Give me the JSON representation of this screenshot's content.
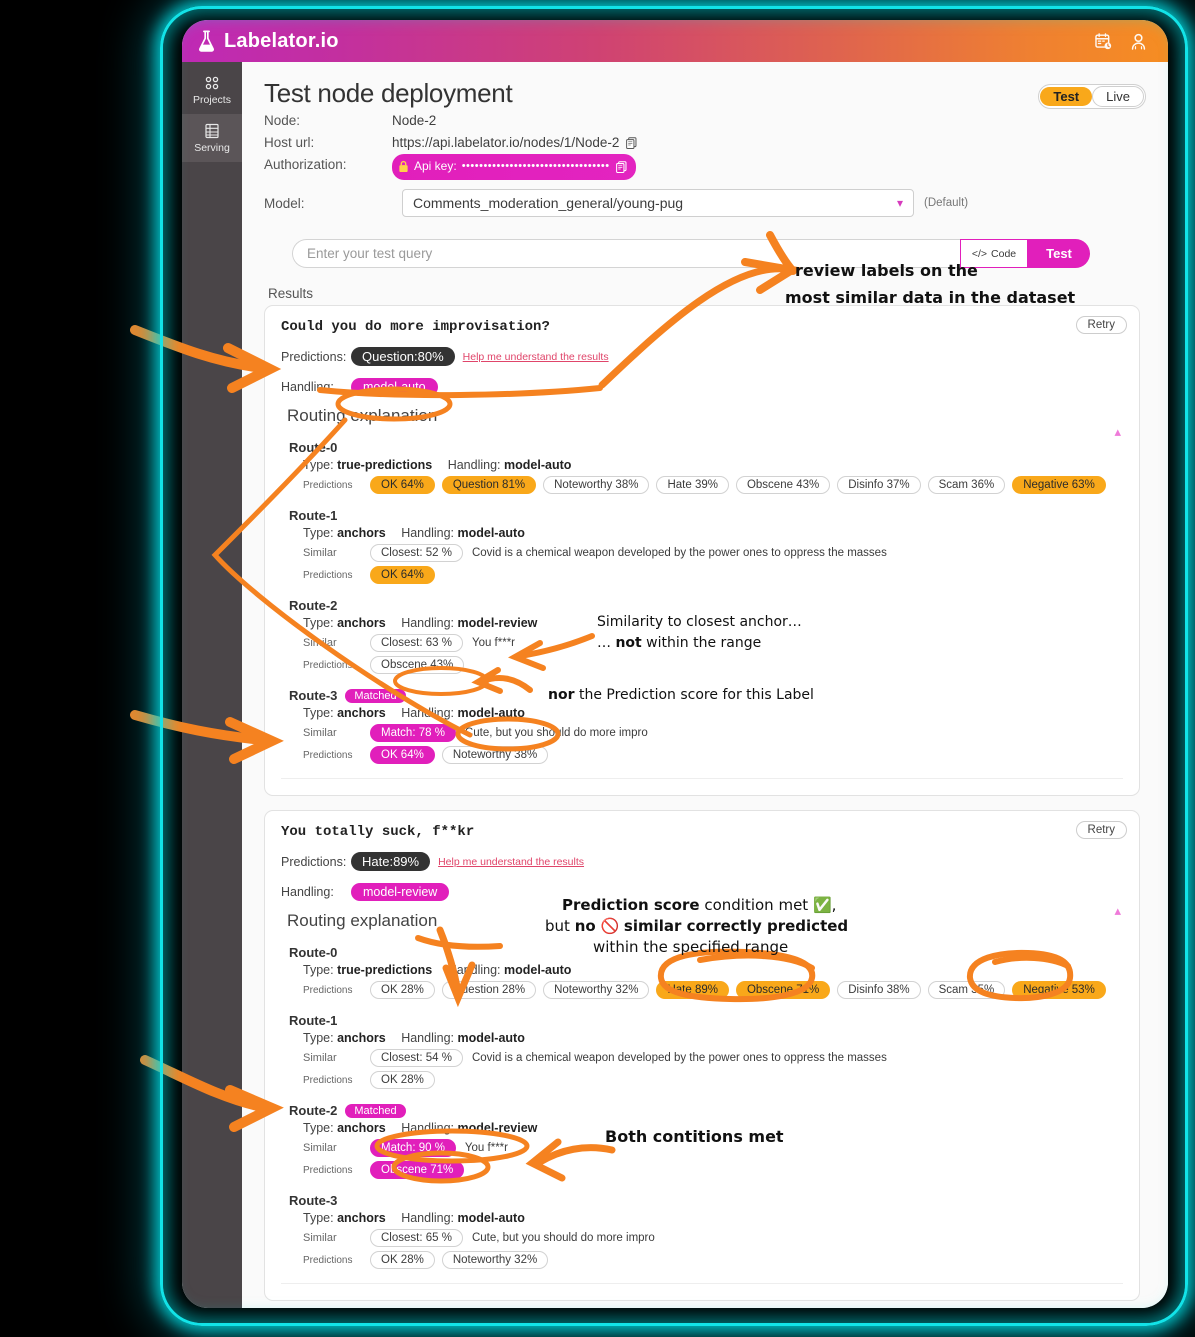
{
  "brand": {
    "name": "Labelator.io",
    "icons": [
      "flask-icon",
      "calendar-clock-icon",
      "user-icon"
    ]
  },
  "sidebar": {
    "items": [
      {
        "label": "Projects",
        "icon": "grid-dots-icon",
        "active": false
      },
      {
        "label": "Serving",
        "icon": "server-icon",
        "active": true
      }
    ]
  },
  "header": {
    "title": "Test node deployment",
    "fields": [
      {
        "key": "Node:",
        "value": "Node-2"
      },
      {
        "key": "Host url:",
        "value": "https://api.labelator.io/nodes/1/Node-2"
      },
      {
        "key": "Authorization:",
        "value": "Api key:",
        "masked": "••••••••••••••••••••••••••••••••••"
      }
    ],
    "model_label": "Model:",
    "model_value": "Comments_moderation_general/young-pug",
    "model_default_note": "(Default)",
    "env_toggle": {
      "active": "Test",
      "inactive": "Live"
    }
  },
  "query": {
    "placeholder": "Enter your test query",
    "code_button": "Code",
    "test_button": "Test"
  },
  "results_label": "Results",
  "results": [
    {
      "query_text": "Could you do more improvisation?",
      "retry_label": "Retry",
      "predictions_label": "Predictions:",
      "prediction_badge": "Question:80%",
      "help_link": "Help me understand the results",
      "handling_label": "Handling:",
      "handling_value": "model-auto",
      "routing_title": "Routing explanation",
      "routes": [
        {
          "name": "Route-0",
          "matched": false,
          "type_label": "Type:",
          "type": "true-predictions",
          "handling_label": "Handling:",
          "handling": "model-auto",
          "similar_label": "Similar",
          "similar": null,
          "similar_text": null,
          "predictions_label": "Predictions",
          "predictions": [
            {
              "label": "OK 64%",
              "style": "orange"
            },
            {
              "label": "Question 81%",
              "style": "orange"
            },
            {
              "label": "Noteworthy 38%",
              "style": "plain"
            },
            {
              "label": "Hate 39%",
              "style": "plain"
            },
            {
              "label": "Obscene 43%",
              "style": "plain"
            },
            {
              "label": "Disinfo 37%",
              "style": "plain"
            },
            {
              "label": "Scam 36%",
              "style": "plain"
            },
            {
              "label": "Negative 63%",
              "style": "orange"
            }
          ]
        },
        {
          "name": "Route-1",
          "matched": false,
          "type_label": "Type:",
          "type": "anchors",
          "handling_label": "Handling:",
          "handling": "model-auto",
          "similar_label": "Similar",
          "similar": {
            "label": "Closest: 52 %",
            "style": "plain"
          },
          "similar_text": "Covid is a chemical weapon developed by the power ones to oppress the masses",
          "predictions_label": "Predictions",
          "predictions": [
            {
              "label": "OK 64%",
              "style": "orange"
            }
          ]
        },
        {
          "name": "Route-2",
          "matched": false,
          "type_label": "Type:",
          "type": "anchors",
          "handling_label": "Handling:",
          "handling": "model-review",
          "similar_label": "Similar",
          "similar": {
            "label": "Closest: 63 %",
            "style": "plain"
          },
          "similar_text": "You f***r",
          "predictions_label": "Predictions",
          "predictions": [
            {
              "label": "Obscene 43%",
              "style": "plain"
            }
          ]
        },
        {
          "name": "Route-3",
          "matched": true,
          "matched_label": "Matched",
          "type_label": "Type:",
          "type": "anchors",
          "handling_label": "Handling:",
          "handling": "model-auto",
          "similar_label": "Similar",
          "similar": {
            "label": "Match: 78 %",
            "style": "magenta"
          },
          "similar_text": "Cute, but you should do more impro",
          "predictions_label": "Predictions",
          "predictions": [
            {
              "label": "OK 64%",
              "style": "magenta"
            },
            {
              "label": "Noteworthy 38%",
              "style": "plain"
            }
          ]
        }
      ]
    },
    {
      "query_text": "You totally suck, f**kr",
      "retry_label": "Retry",
      "predictions_label": "Predictions:",
      "prediction_badge": "Hate:89%",
      "help_link": "Help me understand the results",
      "handling_label": "Handling:",
      "handling_value": "model-review",
      "routing_title": "Routing explanation",
      "routes": [
        {
          "name": "Route-0",
          "matched": false,
          "type_label": "Type:",
          "type": "true-predictions",
          "handling_label": "Handling:",
          "handling": "model-auto",
          "similar_label": "Similar",
          "similar": null,
          "similar_text": null,
          "predictions_label": "Predictions",
          "predictions": [
            {
              "label": "OK 28%",
              "style": "plain"
            },
            {
              "label": "Question 28%",
              "style": "plain"
            },
            {
              "label": "Noteworthy 32%",
              "style": "plain"
            },
            {
              "label": "Hate 89%",
              "style": "orange"
            },
            {
              "label": "Obscene 71%",
              "style": "orange"
            },
            {
              "label": "Disinfo 38%",
              "style": "plain"
            },
            {
              "label": "Scam 35%",
              "style": "plain"
            },
            {
              "label": "Negative 53%",
              "style": "orange"
            }
          ]
        },
        {
          "name": "Route-1",
          "matched": false,
          "type_label": "Type:",
          "type": "anchors",
          "handling_label": "Handling:",
          "handling": "model-auto",
          "similar_label": "Similar",
          "similar": {
            "label": "Closest: 54 %",
            "style": "plain"
          },
          "similar_text": "Covid is a chemical weapon developed by the power ones to oppress the masses",
          "predictions_label": "Predictions",
          "predictions": [
            {
              "label": "OK 28%",
              "style": "plain"
            }
          ]
        },
        {
          "name": "Route-2",
          "matched": true,
          "matched_label": "Matched",
          "type_label": "Type:",
          "type": "anchors",
          "handling_label": "Handling:",
          "handling": "model-review",
          "similar_label": "Similar",
          "similar": {
            "label": "Match: 90 %",
            "style": "magenta"
          },
          "similar_text": "You f***r",
          "predictions_label": "Predictions",
          "predictions": [
            {
              "label": "Obscene 71%",
              "style": "magenta"
            }
          ]
        },
        {
          "name": "Route-3",
          "matched": false,
          "type_label": "Type:",
          "type": "anchors",
          "handling_label": "Handling:",
          "handling": "model-auto",
          "similar_label": "Similar",
          "similar": {
            "label": "Closest: 65 %",
            "style": "plain"
          },
          "similar_text": "Cute, but you should do more impro",
          "predictions_label": "Predictions",
          "predictions": [
            {
              "label": "OK 28%",
              "style": "plain"
            },
            {
              "label": "Noteworthy 32%",
              "style": "plain"
            }
          ]
        }
      ]
    }
  ],
  "annotations": {
    "a1_line1": "review labels on the",
    "a1_line2": "most similar data in the dataset",
    "a2_line1": "Similarity to closest anchor…",
    "a2_line2_pre": "… ",
    "a2_line2_bold": "not",
    "a2_line2_post": " within the range",
    "a3_pre": "nor",
    "a3_post": " the Prediction score for this Label",
    "a4_line1_bold": "Prediction score",
    "a4_line1_post": " condition met ✅,",
    "a4_line2_pre": "but ",
    "a4_line2_bold1": "no",
    "a4_line2_mid": " 🚫 ",
    "a4_line2_bold2": "similar correctly predicted",
    "a4_line3": "within the specified range",
    "a5": "Both contitions met"
  },
  "colors": {
    "accent_magenta": "#e11fbb",
    "accent_orange": "#f9a81a",
    "annotation_orange": "#F58220",
    "frame_cyan": "#12e3e8",
    "sidebar_bg": "#4a4548"
  }
}
